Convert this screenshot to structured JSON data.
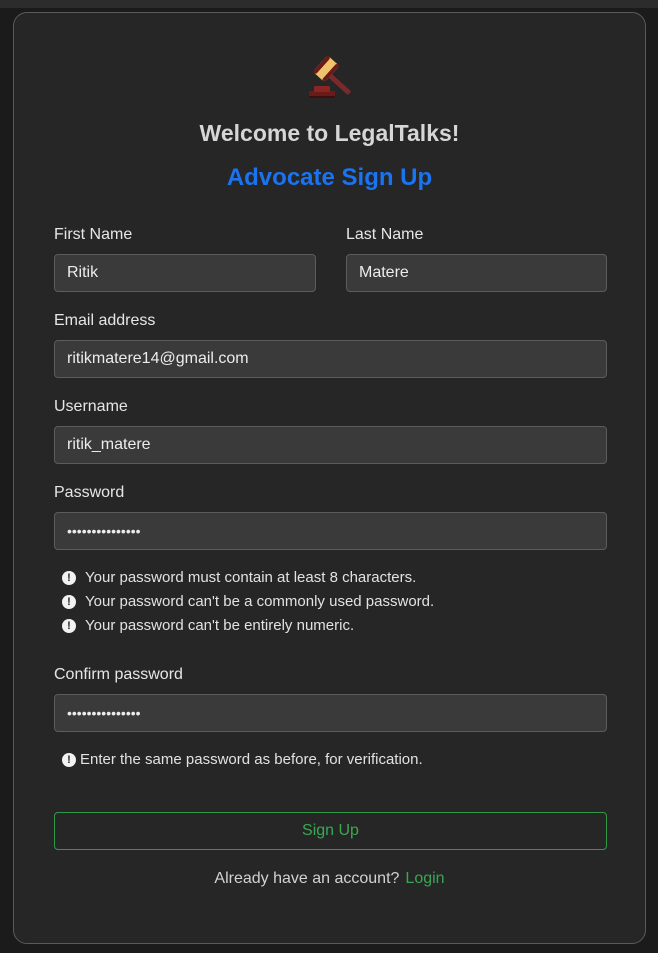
{
  "header": {
    "welcome": "Welcome to LegalTalks!",
    "subtitle": "Advocate Sign Up",
    "logo_icon": "gavel-icon"
  },
  "form": {
    "first_name": {
      "label": "First Name",
      "value": "Ritik"
    },
    "last_name": {
      "label": "Last Name",
      "value": "Matere"
    },
    "email": {
      "label": "Email address",
      "value": "ritikmatere14@gmail.com"
    },
    "username": {
      "label": "Username",
      "value": "ritik_matere"
    },
    "password": {
      "label": "Password",
      "value": "•••••••••••••••"
    },
    "password_hints": [
      "Your password must contain at least 8 characters.",
      "Your password can't be a commonly used password.",
      "Your password can't be entirely numeric."
    ],
    "confirm_password": {
      "label": "Confirm password",
      "value": "•••••••••••••••"
    },
    "confirm_hint": "Enter the same password as before, for verification.",
    "submit_label": "Sign Up"
  },
  "footer": {
    "prompt": "Already have an account?",
    "login_label": "Login"
  },
  "colors": {
    "background": "#262626",
    "accent_blue": "#1a73f0",
    "accent_green": "#39a852",
    "input_bg": "#3a3a3a"
  }
}
